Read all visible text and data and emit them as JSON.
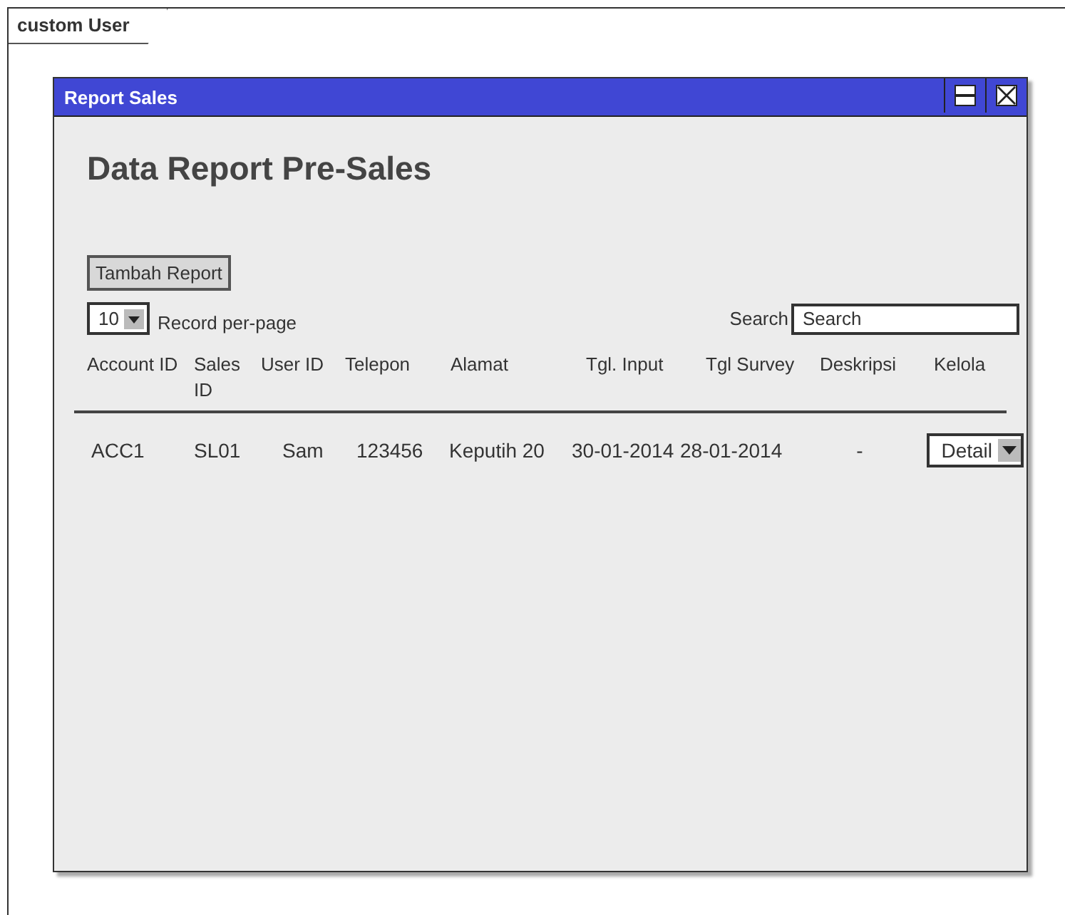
{
  "frame": {
    "label": "custom User"
  },
  "window": {
    "title": "Report Sales",
    "heading": "Data Report Pre-Sales"
  },
  "add_button": "Tambah Report",
  "page_size": {
    "value": "10",
    "label": "Record per-page"
  },
  "search": {
    "label": "Search",
    "placeholder": "Search"
  },
  "table": {
    "columns": [
      "Account ID",
      "Sales ID",
      "User ID",
      "Telepon",
      "Alamat",
      "Tgl. Input",
      "Tgl Survey",
      "Deskripsi",
      "Kelola"
    ],
    "rows": [
      {
        "cells": [
          "ACC1",
          "SL01",
          "Sam",
          "123456",
          "Keputih 20",
          "30-01-2014",
          "28-01-2014",
          "-"
        ],
        "action": "Detail"
      }
    ]
  }
}
